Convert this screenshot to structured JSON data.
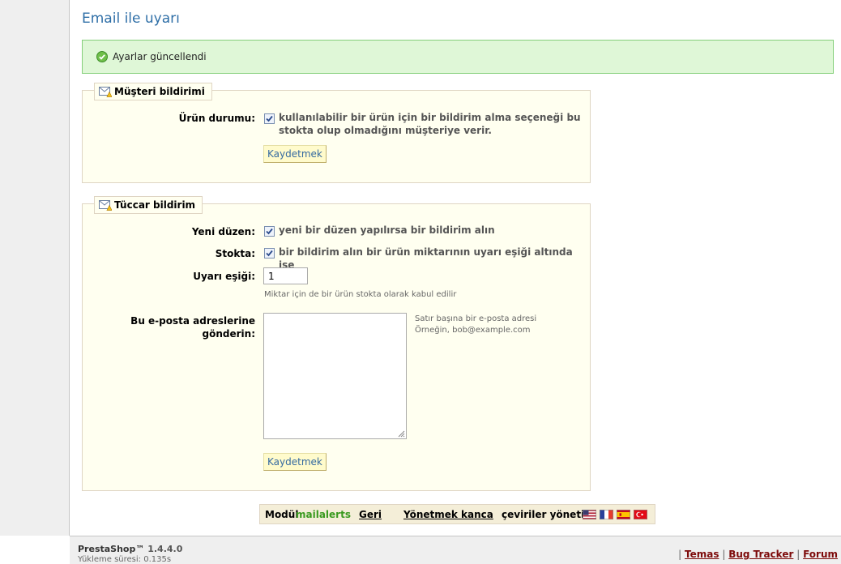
{
  "page": {
    "title": "Email ile uyarı"
  },
  "confirmation": {
    "text": "Ayarlar güncellendi"
  },
  "customer_section": {
    "legend": "Müşteri bildirimi",
    "product_status_label": "Ürün durumu:",
    "product_status_text": "kullanılabilir bir ürün için bir bildirim alma seçeneği bu stokta olup olmadığını müşteriye verir.",
    "product_status_checked": true,
    "save_label": "Kaydetmek"
  },
  "merchant_section": {
    "legend": "Tüccar bildirim",
    "new_order_label": "Yeni düzen:",
    "new_order_text": "yeni bir düzen yapılırsa bir bildirim alın",
    "new_order_checked": true,
    "stock_label": "Stokta:",
    "stock_text": "bir bildirim alın bir ürün miktarının uyarı eşiği altında ise",
    "stock_checked": true,
    "threshold_label": "Uyarı eşiği:",
    "threshold_value": "1",
    "threshold_note": "Miktar için de bir ürün stokta olarak kabul edilir",
    "emails_label_line1": "Bu e-posta adreslerine",
    "emails_label_line2": "gönderin:",
    "emails_value": "",
    "emails_note_line1": "Satır başına bir e-posta adresi",
    "emails_note_line2": "Örneğin, bob@example.com",
    "save_label": "Kaydetmek"
  },
  "module_bar": {
    "module_prefix": "Modül",
    "module_name": "mailalerts",
    "back_label": "Geri",
    "manage_hook_label": "Yönetmek kanca",
    "translations_label": "çeviriler yönetin:",
    "flags": [
      "flag-us-icon",
      "flag-fr-icon",
      "flag-es-icon",
      "flag-tr-icon"
    ]
  },
  "footer": {
    "brand": "PrestaShop™",
    "version": "1.4.4.0",
    "load_time": "Yükleme süresi: 0.135s",
    "separator": "|",
    "links": [
      "Temas",
      "Bug Tracker",
      "Forum"
    ]
  },
  "colors": {
    "title": "#2f6fa7",
    "success_bg": "#dff7d7",
    "success_border": "#84cf7a",
    "fieldset_bg": "#fffff0",
    "module_name": "#3a9a1f",
    "footer_link": "#7d0a0a"
  }
}
